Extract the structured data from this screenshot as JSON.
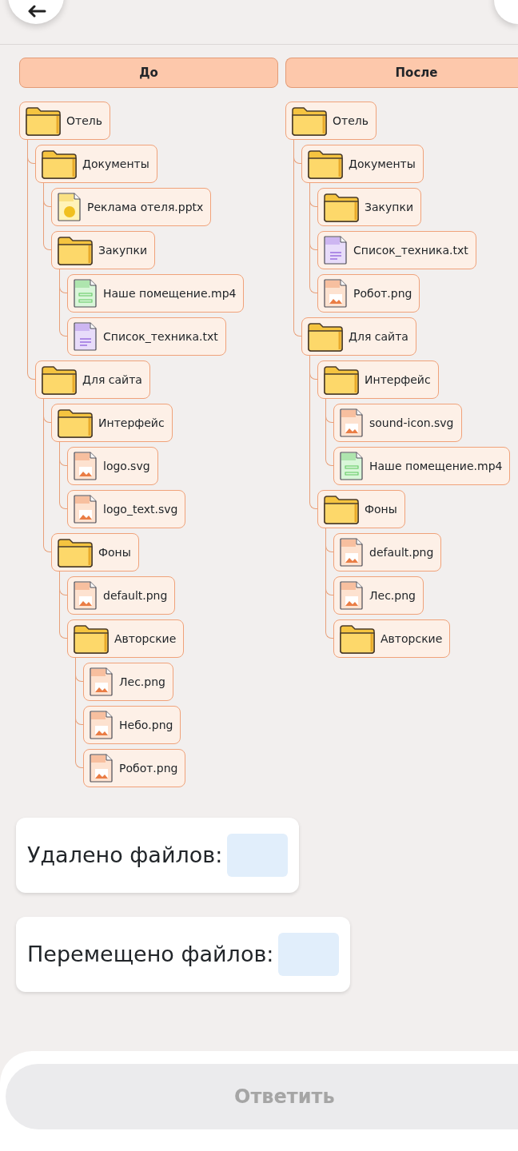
{
  "columns": [
    {
      "title": "До",
      "tree": [
        {
          "name": "Отель",
          "kind": "folder",
          "children": [
            {
              "name": "Документы",
              "kind": "folder",
              "children": [
                {
                  "name": "Реклама отеля.pptx",
                  "kind": "pptx"
                },
                {
                  "name": "Закупки",
                  "kind": "folder",
                  "children": [
                    {
                      "name": "Наше помещение.mp4",
                      "kind": "mp4"
                    },
                    {
                      "name": "Список_техника.txt",
                      "kind": "txt"
                    }
                  ]
                }
              ]
            },
            {
              "name": "Для сайта",
              "kind": "folder",
              "children": [
                {
                  "name": "Интерфейс",
                  "kind": "folder",
                  "children": [
                    {
                      "name": "logo.svg",
                      "kind": "svg"
                    },
                    {
                      "name": "logo_text.svg",
                      "kind": "svg"
                    }
                  ]
                },
                {
                  "name": "Фоны",
                  "kind": "folder",
                  "children": [
                    {
                      "name": "default.png",
                      "kind": "png"
                    },
                    {
                      "name": "Авторские",
                      "kind": "folder",
                      "children": [
                        {
                          "name": "Лес.png",
                          "kind": "png"
                        },
                        {
                          "name": "Небо.png",
                          "kind": "png"
                        },
                        {
                          "name": "Робот.png",
                          "kind": "png"
                        }
                      ]
                    }
                  ]
                }
              ]
            }
          ]
        }
      ]
    },
    {
      "title": "После",
      "tree": [
        {
          "name": "Отель",
          "kind": "folder",
          "children": [
            {
              "name": "Документы",
              "kind": "folder",
              "children": [
                {
                  "name": "Закупки",
                  "kind": "folder"
                },
                {
                  "name": "Список_техника.txt",
                  "kind": "txt"
                },
                {
                  "name": "Робот.png",
                  "kind": "png"
                }
              ]
            },
            {
              "name": "Для сайта",
              "kind": "folder",
              "children": [
                {
                  "name": "Интерфейс",
                  "kind": "folder",
                  "children": [
                    {
                      "name": "sound-icon.svg",
                      "kind": "svg"
                    },
                    {
                      "name": "Наше помещение.mp4",
                      "kind": "mp4"
                    }
                  ]
                },
                {
                  "name": "Фоны",
                  "kind": "folder",
                  "children": [
                    {
                      "name": "default.png",
                      "kind": "png"
                    },
                    {
                      "name": "Лес.png",
                      "kind": "png"
                    },
                    {
                      "name": "Авторские",
                      "kind": "folder"
                    }
                  ]
                }
              ]
            }
          ]
        }
      ]
    }
  ],
  "answers": [
    {
      "label": "Удалено файлов:"
    },
    {
      "label": "Перемещено файлов:"
    }
  ],
  "submit": {
    "label": "Ответить",
    "disabled": true
  }
}
